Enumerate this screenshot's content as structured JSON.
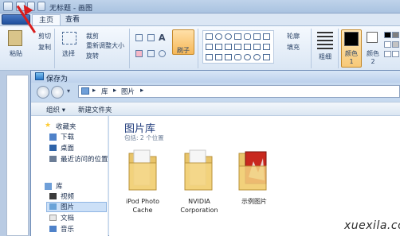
{
  "paint": {
    "title": "无标题 - 画图",
    "tabs": [
      "主页",
      "查看"
    ],
    "ribbon": {
      "paste": "粘贴",
      "cut": "剪切",
      "copy": "复制",
      "select": "选择",
      "crop": "裁剪",
      "resize": "重新调整大小",
      "rotate": "旋转",
      "brushes": "刷子",
      "outline": "轮廓",
      "fill": "填充",
      "thickness": "粗细",
      "color1": "颜色 1",
      "color2": "颜色 2",
      "clip_label": "剪贴",
      "shapes_label": "状"
    },
    "colors": {
      "accent": "#d81e1e"
    }
  },
  "dialog": {
    "title": "保存为",
    "address": [
      "库",
      "图片"
    ],
    "toolbar": {
      "organize": "组织 ▾",
      "new_folder": "新建文件夹"
    },
    "nav": {
      "favorites": "收藏夹",
      "downloads": "下载",
      "desktop": "桌面",
      "recent": "最近访问的位置",
      "libraries": "库",
      "videos": "视频",
      "pictures": "图片",
      "documents": "文档",
      "music": "音乐"
    },
    "library_title": "图片库",
    "library_sub": "包括: 2 个位置",
    "folders": [
      {
        "name": "iPod Photo Cache"
      },
      {
        "name": "NVIDIA Corporation"
      },
      {
        "name": "示例图片"
      }
    ]
  },
  "watermark": "xuexila.com"
}
